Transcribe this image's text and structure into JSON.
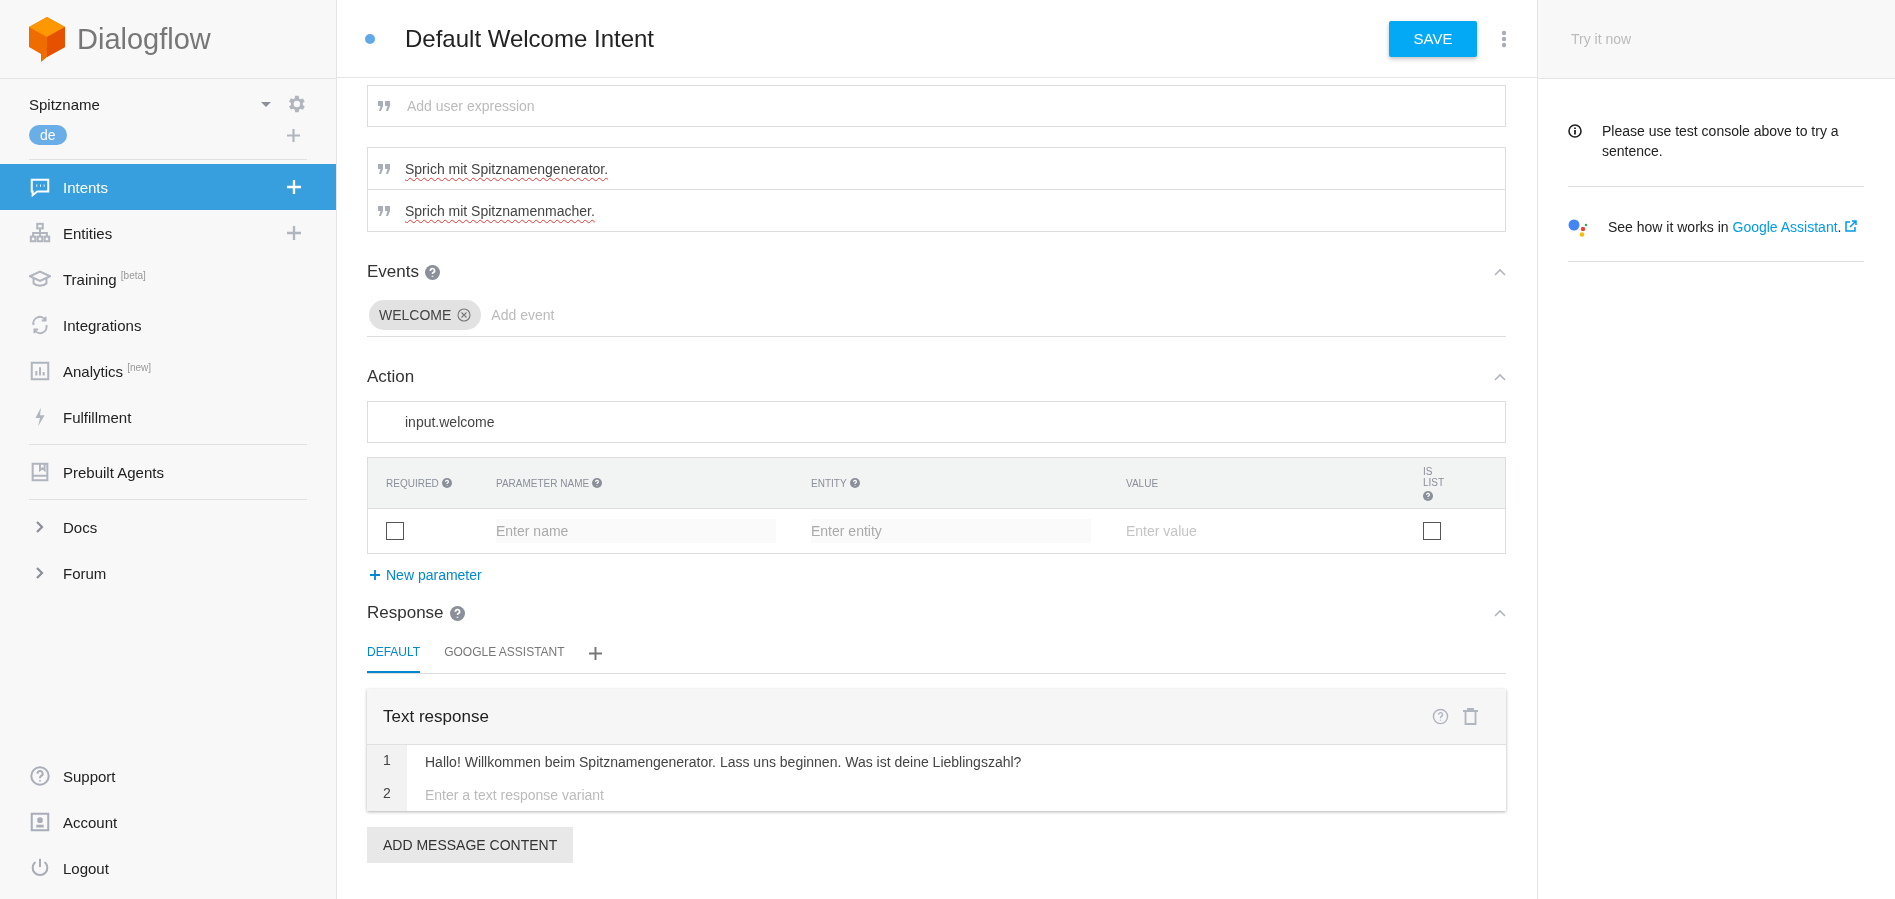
{
  "sidebar": {
    "logo": "Dialogflow",
    "agent": "Spitzname",
    "language": "de",
    "nav": [
      {
        "label": "Intents",
        "selected": true,
        "add": true
      },
      {
        "label": "Entities",
        "selected": false,
        "add": true
      },
      {
        "label": "Training $^{[beta]}$",
        "selected": false,
        "add": false
      },
      {
        "label": "Integrations",
        "selected": false,
        "add": false
      },
      {
        "label": "Analytics $^{[new]}$",
        "selected": false,
        "add": false
      },
      {
        "label": "Fulfillment",
        "selected": false,
        "add": false
      }
    ],
    "prebuilt": "Prebuilt Agents",
    "links": [
      "Docs",
      "Forum"
    ],
    "footer": [
      "Support",
      "Account",
      "Logout"
    ]
  },
  "header": {
    "title": "Default Welcome Intent",
    "save": "SAVE"
  },
  "training_phrases": {
    "placeholder": "Add user expression",
    "items": [
      "Sprich mit Spitznamengenerator.",
      "Sprich mit Spitznamenmacher."
    ]
  },
  "events": {
    "title": "Events",
    "expanded": true,
    "chips": [
      "WELCOME"
    ],
    "placeholder": "Add event"
  },
  "action": {
    "title": "Action",
    "expanded": true,
    "value": "input.welcome",
    "columns": [
      {
        "label": "REQUIRED",
        "help": true
      },
      {
        "label": "PARAMETER NAME",
        "help": true
      },
      {
        "label": "ENTITY",
        "help": true
      },
      {
        "label": "VALUE",
        "help": false
      },
      {
        "label": "IS LIST",
        "help": true
      }
    ],
    "row": {
      "required": false,
      "name_placeholder": "Enter name",
      "entity_placeholder": "Enter entity",
      "value_placeholder": "Enter value",
      "is_list": false
    },
    "new_parameter": "New parameter"
  },
  "response": {
    "title": "Response",
    "expanded": true,
    "tabs": [
      {
        "label": "DEFAULT",
        "selected": true
      },
      {
        "label": "GOOGLE ASSISTANT",
        "selected": false
      }
    ],
    "card": {
      "title": "Text response",
      "lines": [
        {
          "number": "1",
          "value": "Hallo! Willkommen beim Spitznamengenerator. Lass uns beginnen. Was ist deine Lieblingszahl?"
        },
        {
          "number": "2",
          "placeholder": "Enter a text response variant"
        }
      ]
    },
    "add_content": "ADD MESSAGE CONTENT"
  },
  "test_panel": {
    "placeholder": "Try it now",
    "notes": [
      {
        "kind": "info",
        "text": "Please use test console above to try a sentence."
      },
      {
        "kind": "assistant",
        "text": "See how it works in",
        "link": "Google Assistant",
        "after": "."
      }
    ]
  }
}
